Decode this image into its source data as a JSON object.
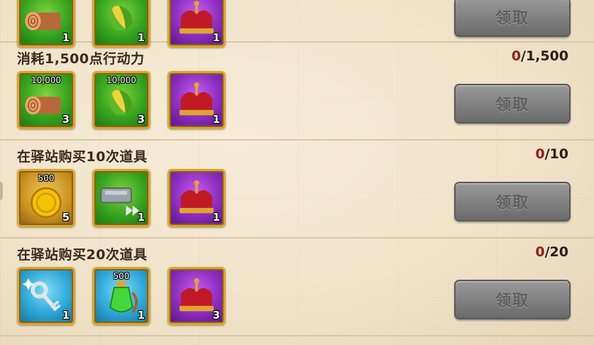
{
  "claim_label": "领取",
  "rows": [
    {
      "title": "",
      "progress_current": "",
      "progress_total": "",
      "items": [
        {
          "icon": "wood-icon",
          "bg": "green",
          "count": "1",
          "amount": ""
        },
        {
          "icon": "corn-icon",
          "bg": "green",
          "count": "1",
          "amount": ""
        },
        {
          "icon": "crown-icon",
          "bg": "purple",
          "count": "1",
          "amount": ""
        }
      ]
    },
    {
      "title": "消耗1,500点行动力",
      "progress_current": "0",
      "progress_total": "/1,500",
      "items": [
        {
          "icon": "wood-icon",
          "bg": "green",
          "count": "3",
          "amount": "10,000"
        },
        {
          "icon": "corn-icon",
          "bg": "green",
          "count": "3",
          "amount": "10,000"
        },
        {
          "icon": "crown-icon",
          "bg": "purple",
          "count": "1",
          "amount": ""
        }
      ]
    },
    {
      "title": "在驿站购买10次道具",
      "progress_current": "0",
      "progress_total": "/10",
      "items": [
        {
          "icon": "gold-coin-icon",
          "bg": "gold",
          "count": "5",
          "amount": "500"
        },
        {
          "icon": "speedup-icon",
          "bg": "green",
          "count": "1",
          "amount": ""
        },
        {
          "icon": "crown-icon",
          "bg": "purple",
          "count": "1",
          "amount": ""
        }
      ]
    },
    {
      "title": "在驿站购买20次道具",
      "progress_current": "0",
      "progress_total": "/20",
      "items": [
        {
          "icon": "silver-key-icon",
          "bg": "blue",
          "count": "1",
          "amount": ""
        },
        {
          "icon": "potion-icon",
          "bg": "blue",
          "count": "1",
          "amount": "500"
        },
        {
          "icon": "crown-icon",
          "bg": "purple",
          "count": "3",
          "amount": ""
        }
      ]
    }
  ]
}
